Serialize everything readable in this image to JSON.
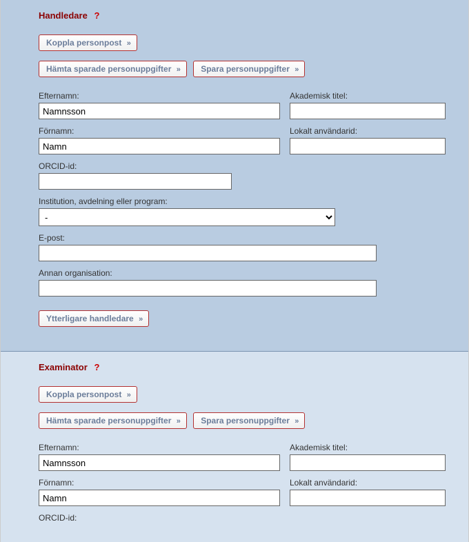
{
  "handledare": {
    "title": "Handledare",
    "help": "?",
    "buttons": {
      "koppla": "Koppla personpost",
      "hamta": "Hämta sparade personuppgifter",
      "spara": "Spara personuppgifter"
    },
    "labels": {
      "efternamn": "Efternamn:",
      "akademisk": "Akademisk titel:",
      "fornamn": "Förnamn:",
      "lokalt": "Lokalt användarid:",
      "orcid": "ORCID-id:",
      "institution": "Institution, avdelning eller program:",
      "epost": "E-post:",
      "annan": "Annan organisation:"
    },
    "values": {
      "efternamn": "Namnsson",
      "akademisk": "",
      "fornamn": "Namn",
      "lokalt": "",
      "orcid": "",
      "institution": "-",
      "epost": "",
      "annan": ""
    },
    "ytterligare": "Ytterligare handledare"
  },
  "examinator": {
    "title": "Examinator",
    "help": "?",
    "buttons": {
      "koppla": "Koppla personpost",
      "hamta": "Hämta sparade personuppgifter",
      "spara": "Spara personuppgifter"
    },
    "labels": {
      "efternamn": "Efternamn:",
      "akademisk": "Akademisk titel:",
      "fornamn": "Förnamn:",
      "lokalt": "Lokalt användarid:",
      "orcid": "ORCID-id:"
    },
    "values": {
      "efternamn": "Namnsson",
      "akademisk": "",
      "fornamn": "Namn",
      "lokalt": ""
    }
  },
  "arrows": "»"
}
